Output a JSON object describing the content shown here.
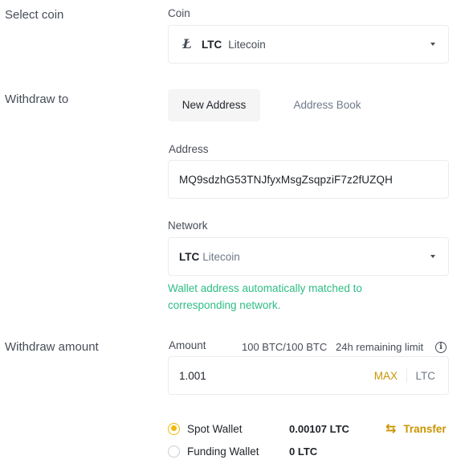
{
  "sections": {
    "select_coin": "Select coin",
    "withdraw_to": "Withdraw to",
    "withdraw_amount": "Withdraw amount"
  },
  "coin": {
    "label": "Coin",
    "icon": "litecoin-icon",
    "icon_glyph": "Ł",
    "symbol": "LTC",
    "name": "Litecoin"
  },
  "tabs": [
    {
      "label": "New Address",
      "active": true
    },
    {
      "label": "Address Book",
      "active": false
    }
  ],
  "address": {
    "label": "Address",
    "value": "MQ9sdzhG53TNJfyxMsgZsqpziF7z2fUZQH"
  },
  "network": {
    "label": "Network",
    "symbol": "LTC",
    "name": "Litecoin",
    "hint": "Wallet address automatically matched to corresponding network."
  },
  "amount": {
    "label": "Amount",
    "limit_value": "100 BTC/100 BTC",
    "limit_text": "24h remaining limit",
    "info_glyph": "i",
    "value": "1.001",
    "max_label": "MAX",
    "unit": "LTC"
  },
  "wallets": [
    {
      "name": "Spot Wallet",
      "balance": "0.00107 LTC",
      "selected": true
    },
    {
      "name": "Funding Wallet",
      "balance": "0 LTC",
      "selected": false
    }
  ],
  "transfer": {
    "label": "Transfer",
    "icon_glyph": "⇆"
  },
  "colors": {
    "accent": "#f0b90b",
    "link": "#c99400",
    "success": "#2ebd85"
  }
}
